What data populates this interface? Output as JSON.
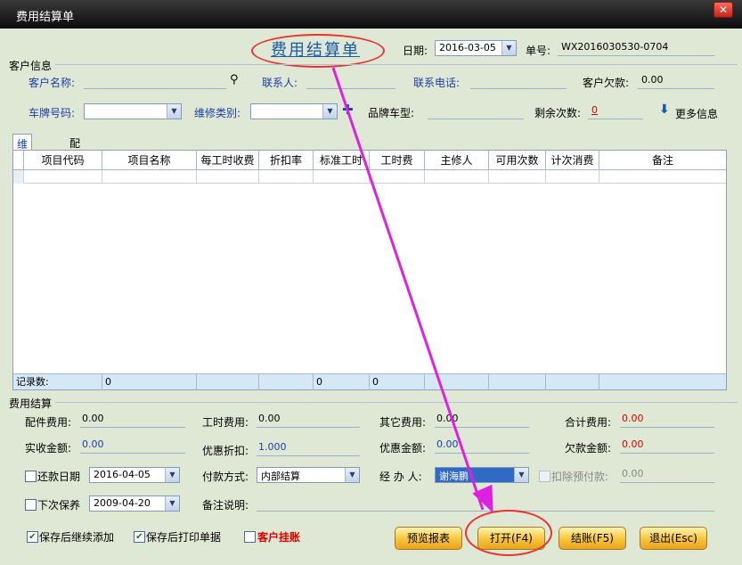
{
  "window": {
    "title": "费用结算单",
    "close": "✕"
  },
  "header": {
    "doc_title": "费用结算单",
    "date_label": "日期:",
    "date_value": "2016-03-05",
    "order_no_label": "单号:",
    "order_no_value": "WX2016030530-0704"
  },
  "customer": {
    "section_label": "客户信息",
    "name_label": "客户名称:",
    "contact_label": "联系人:",
    "phone_label": "联系电话:",
    "debt_label": "客户欠款:",
    "debt_value": "0.00",
    "plate_label": "车牌号码:",
    "repair_type_label": "维修类别:",
    "brand_label": "品牌车型:",
    "remaining_label": "剩余次数:",
    "remaining_value": "0",
    "more_info": "更多信息"
  },
  "tabs": [
    {
      "label": "维修项目"
    },
    {
      "label": "配件项目"
    }
  ],
  "grid": {
    "columns": [
      "项目代码",
      "项目名称",
      "每工时收费",
      "折扣率",
      "标准工时",
      "工时费",
      "主修人",
      "可用次数",
      "计次消费",
      "备注"
    ],
    "footer": {
      "label": "记录数:",
      "count": "0",
      "std_hours": "0",
      "labor_fee": "0"
    }
  },
  "settlement": {
    "section_label": "费用结算",
    "parts_fee_label": "配件费用:",
    "parts_fee_value": "0.00",
    "labor_fee_label": "工时费用:",
    "labor_fee_value": "0.00",
    "other_fee_label": "其它费用:",
    "other_fee_value": "0.00",
    "total_label": "合计费用:",
    "total_value": "0.00",
    "received_label": "实收金额:",
    "received_value": "0.00",
    "discount_label": "优惠折扣:",
    "discount_value": "1.000",
    "discount_amount_label": "优惠金额:",
    "discount_amount_value": "0.00",
    "owed_label": "欠款金额:",
    "owed_value": "0.00",
    "repay_date_label": "还款日期",
    "repay_date_value": "2016-04-05",
    "payment_label": "付款方式:",
    "payment_value": "内部结算",
    "handler_label": "经 办 人:",
    "handler_value": "谢海鹏",
    "deduct_label": "扣除预付款:",
    "deduct_value": "0.00",
    "next_maint_label": "下次保养",
    "next_maint_value": "2009-04-20",
    "remark_label": "备注说明:"
  },
  "options": {
    "save_continue": "保存后继续添加",
    "save_print": "保存后打印单据",
    "customer_hold": "客户挂账"
  },
  "buttons": {
    "preview": "预览报表",
    "open": "打开(F4)",
    "checkout": "结账(F5)",
    "exit": "退出(Esc)"
  },
  "colors": {
    "accent_blue": "#1a3fa5",
    "annotation_red": "#e8332e",
    "arrow_magenta": "#e020e0",
    "button_gold": "#f7c43a"
  }
}
